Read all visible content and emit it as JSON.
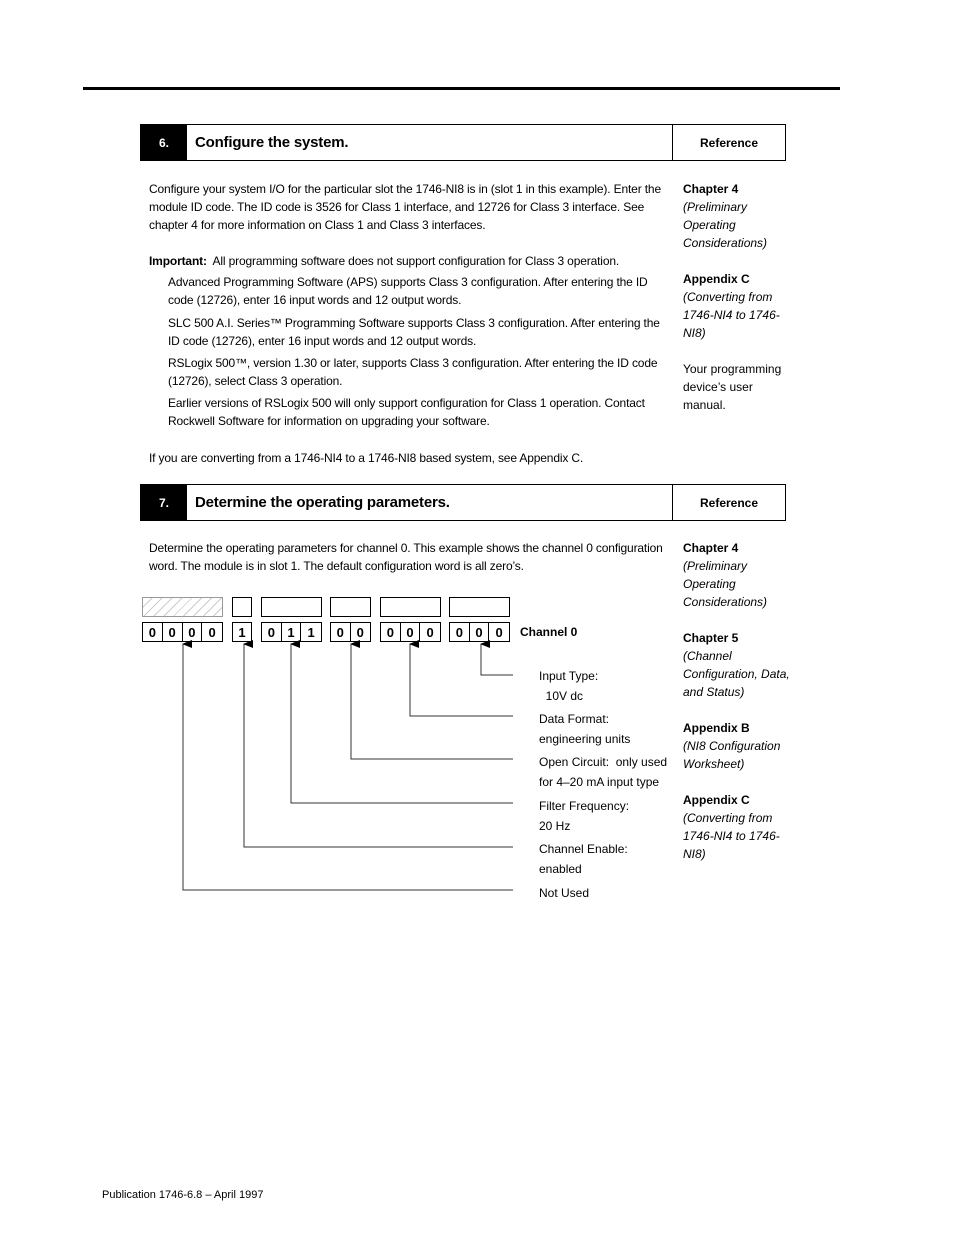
{
  "section6": {
    "number": "6.",
    "title": "Configure the system.",
    "reference_header": "Reference",
    "paragraph1": "Configure your system I/O for the particular slot the 1746-NI8 is in (slot 1 in this example).  Enter the module ID code.  The ID code is 3526 for Class 1 interface, and 12726 for Class 3 interface.  See chapter 4 for more information on Class 1 and Class 3 interfaces.",
    "important_label": "Important:",
    "important_text": "  All programming software does not support configuration for Class 3 operation.",
    "items": [
      "Advanced Programming Software (APS) supports Class 3 configuration.  After entering the ID code (12726), enter 16 input words and 12 output words.",
      "SLC 500 A.I. Series™  Programming Software supports Class 3 configuration.  After entering the ID code (12726), enter 16 input words and 12 output words.",
      "RSLogix 500™, version 1.30 or later, supports Class 3 configuration.  After entering the ID code (12726), select Class 3 operation.",
      "Earlier versions of RSLogix 500 will only support configuration for Class 1 operation.  Contact Rockwell Software for information on upgrading your software."
    ],
    "closing": "If you are converting from a 1746-NI4 to a 1746-NI8 based system, see Appendix C.",
    "references": [
      {
        "title": "Chapter 4",
        "subtitle": "(Preliminary Operating Considerations)"
      },
      {
        "title": "Appendix C",
        "subtitle": "(Converting from 1746-NI4 to 1746-NI8)"
      },
      {
        "title": "",
        "subtitle": "",
        "plain": "Your programming device’s user manual."
      }
    ]
  },
  "section7": {
    "number": "7.",
    "title": "Determine the operating parameters.",
    "reference_header": "Reference",
    "paragraph1": "Determine the operating parameters for channel 0.  This example shows the channel 0 configuration word.  The module is in slot 1.  The default configuration word is all zero’s.",
    "diagram": {
      "channel_label": "Channel 0",
      "groups": [
        {
          "bits": [
            "0",
            "0",
            "0",
            "0"
          ],
          "hatched": true
        },
        {
          "bits": [
            "1"
          ]
        },
        {
          "bits": [
            "0",
            "1",
            "1"
          ]
        },
        {
          "bits": [
            "0",
            "0"
          ]
        },
        {
          "bits": [
            "0",
            "0",
            "0"
          ]
        },
        {
          "bits": [
            "0",
            "0",
            "0"
          ]
        }
      ],
      "labels": [
        {
          "line1": "Input Type:",
          "line2": "  10V dc"
        },
        {
          "line1": "Data Format:",
          "line2": "engineering units"
        },
        {
          "line1": "Open Circuit:  only used",
          "line2": "for 4–20 mA input type"
        },
        {
          "line1": "Filter Frequency:",
          "line2": "20 Hz"
        },
        {
          "line1": "Channel Enable:",
          "line2": "enabled"
        },
        {
          "line1": "Not Used",
          "line2": ""
        }
      ]
    },
    "references": [
      {
        "title": "Chapter 4",
        "subtitle": "(Preliminary Operating Considerations)"
      },
      {
        "title": "Chapter 5",
        "subtitle": "(Channel Configuration, Data, and Status)"
      },
      {
        "title": "Appendix B",
        "subtitle": "(NI8 Configuration Worksheet)"
      },
      {
        "title": "Appendix C",
        "subtitle": "(Converting from 1746-NI4 to 1746-NI8)"
      }
    ]
  },
  "footer": {
    "publication": "Publication 1746-6.8 – April 1997"
  }
}
